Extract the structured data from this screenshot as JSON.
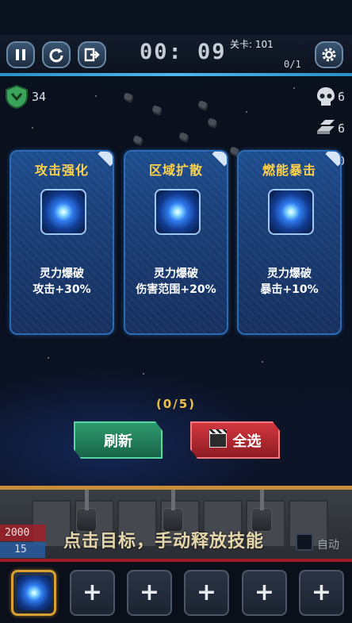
{
  "hud": {
    "timer": "00: 09",
    "level_label": "关卡: 101",
    "wave_progress": "0/1",
    "shield_value": "34",
    "kills_value": "6",
    "metal_value": "6",
    "third_value": "0"
  },
  "cards": [
    {
      "title": "攻击强化",
      "skill_name": "灵力爆破",
      "effect": "攻击+30%"
    },
    {
      "title": "区域扩散",
      "skill_name": "灵力爆破",
      "effect": "伤害范围+20%"
    },
    {
      "title": "燃能暴击",
      "skill_name": "灵力爆破",
      "effect": "暴击+10%"
    }
  ],
  "selection_count": "(0/5)",
  "buttons": {
    "refresh_label": "刷新",
    "select_all_label": "全选"
  },
  "player": {
    "hp": "2000",
    "mp": "15"
  },
  "hint_text": "点击目标，手动释放技能",
  "auto_label": "自动",
  "slot_empty_symbol": "+",
  "colors": {
    "accent_gold": "#ffd24a",
    "card_blue": "#1d4d8e",
    "refresh_green": "#2e9a6e",
    "select_red": "#d2373f"
  }
}
